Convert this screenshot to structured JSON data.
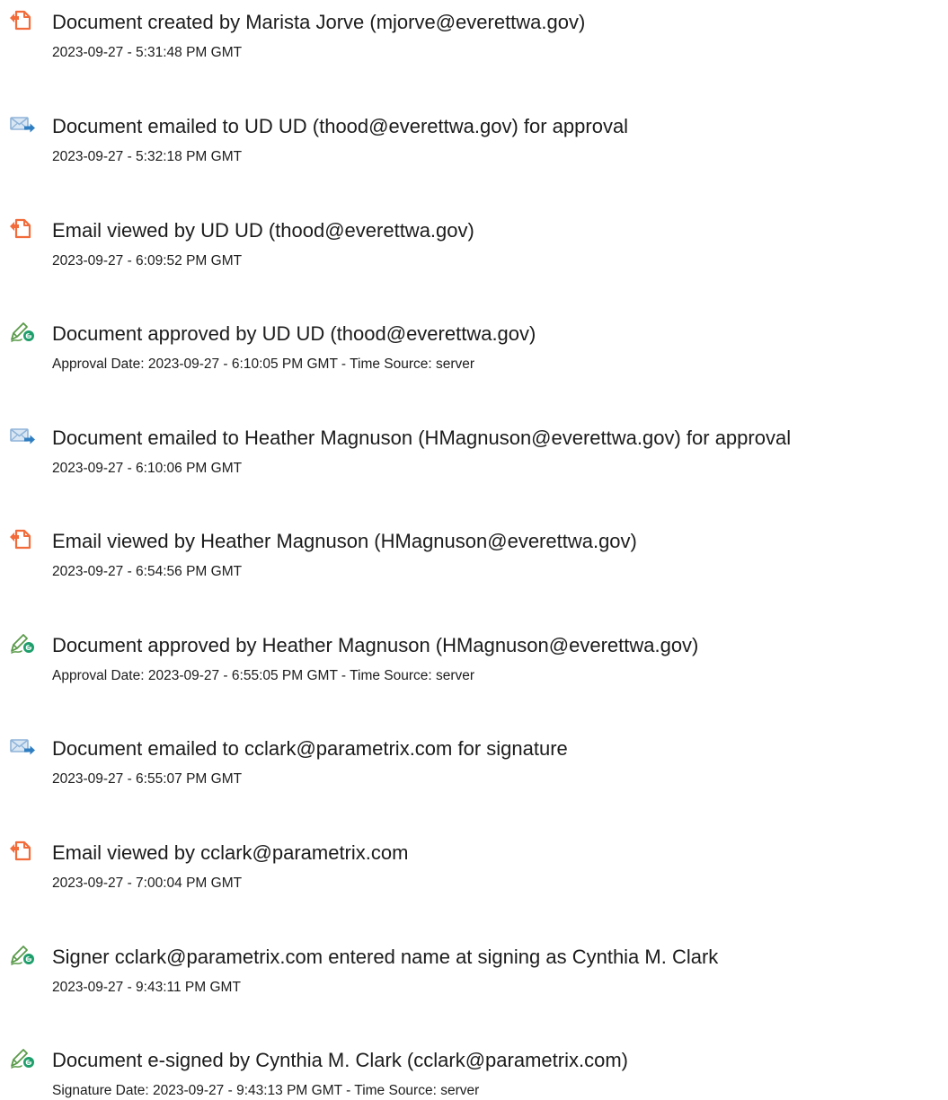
{
  "colors": {
    "created": "#f26b3a",
    "emailed": "#8fb4d9",
    "emailed_arrow": "#2f7ec1",
    "approved_pen": "#5a9a4a",
    "approved_badge": "#1e9e6b"
  },
  "events": [
    {
      "icon": "document-created-icon",
      "title": "Document created by Marista Jorve (mjorve@everettwa.gov)",
      "detail": "2023-09-27 - 5:31:48 PM GMT"
    },
    {
      "icon": "email-sent-icon",
      "title": "Document emailed to UD UD (thood@everettwa.gov) for approval",
      "detail": "2023-09-27 - 5:32:18 PM GMT"
    },
    {
      "icon": "document-viewed-icon",
      "title": "Email viewed by UD UD (thood@everettwa.gov)",
      "detail": "2023-09-27 - 6:09:52 PM GMT"
    },
    {
      "icon": "approved-pen-icon",
      "title": "Document approved by UD UD (thood@everettwa.gov)",
      "detail": "Approval Date: 2023-09-27 - 6:10:05 PM GMT - Time Source: server"
    },
    {
      "icon": "email-sent-icon",
      "title": "Document emailed to Heather Magnuson (HMagnuson@everettwa.gov) for approval",
      "detail": "2023-09-27 - 6:10:06 PM GMT"
    },
    {
      "icon": "document-viewed-icon",
      "title": "Email viewed by Heather Magnuson (HMagnuson@everettwa.gov)",
      "detail": "2023-09-27 - 6:54:56 PM GMT"
    },
    {
      "icon": "approved-pen-icon",
      "title": "Document approved by Heather Magnuson (HMagnuson@everettwa.gov)",
      "detail": "Approval Date: 2023-09-27 - 6:55:05 PM GMT - Time Source: server"
    },
    {
      "icon": "email-sent-icon",
      "title": "Document emailed to cclark@parametrix.com for signature",
      "detail": "2023-09-27 - 6:55:07 PM GMT"
    },
    {
      "icon": "document-viewed-icon",
      "title": "Email viewed by cclark@parametrix.com",
      "detail": "2023-09-27 - 7:00:04 PM GMT"
    },
    {
      "icon": "signer-pen-icon",
      "title": "Signer cclark@parametrix.com entered name at signing as Cynthia M. Clark",
      "detail": "2023-09-27 - 9:43:11 PM GMT"
    },
    {
      "icon": "signed-pen-icon",
      "title": "Document e-signed by Cynthia M. Clark (cclark@parametrix.com)",
      "detail": "Signature Date: 2023-09-27 - 9:43:13 PM GMT - Time Source: server"
    }
  ]
}
